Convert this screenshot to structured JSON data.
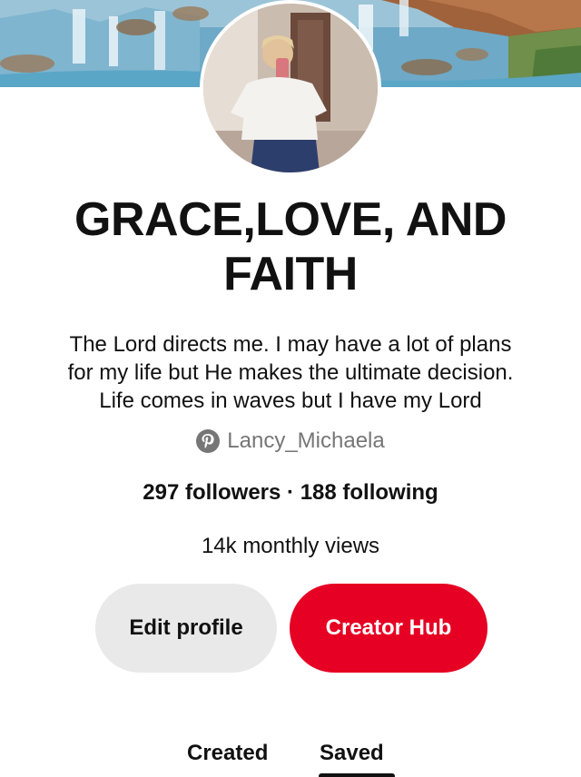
{
  "profile": {
    "display_name_line1": "GRACE,LOVE, AND",
    "display_name_line2": "FAITH",
    "bio_line1": "The Lord directs me. I may have a lot of plans",
    "bio_line2": "for my life but He makes the ultimate decision.",
    "bio_line3": "Life comes in waves but I have my Lord",
    "handle": "Lancy_Michaela",
    "handle_icon": "pinterest-icon",
    "stats": "297 followers · 188 following",
    "monthly_views": "14k monthly views"
  },
  "actions": {
    "edit_profile_label": "Edit profile",
    "creator_hub_label": "Creator Hub"
  },
  "tabs": {
    "created_label": "Created",
    "saved_label": "Saved",
    "active": "Saved"
  },
  "colors": {
    "brand_red": "#e60023",
    "secondary_button": "#e9e9e9",
    "muted_text": "#767676"
  }
}
